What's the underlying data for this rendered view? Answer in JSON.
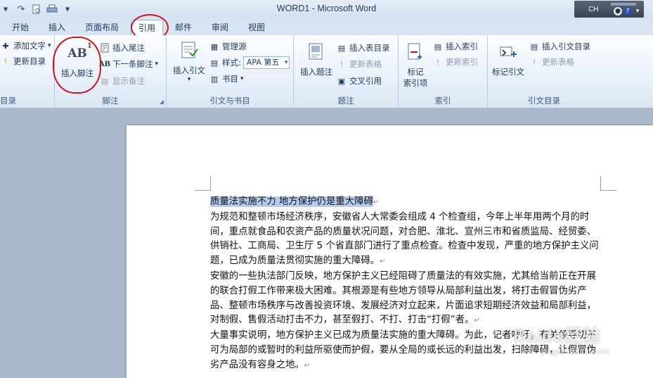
{
  "window": {
    "title": "WORD1  -  Microsoft Word"
  },
  "lang_indicator": {
    "label": "CH"
  },
  "help_button": {
    "label": "?"
  },
  "tabs": [
    {
      "label": "开始"
    },
    {
      "label": "插入"
    },
    {
      "label": "页面布局"
    },
    {
      "label": "引用"
    },
    {
      "label": "邮件"
    },
    {
      "label": "审阅"
    },
    {
      "label": "视图"
    }
  ],
  "ribbon": {
    "toc_group": {
      "label": "目录",
      "add_text": "添加文字",
      "update_toc": "更新目录"
    },
    "footnote_group": {
      "label": "脚注",
      "insert_footnote": "插入脚注",
      "insert_endnote": "插入尾注",
      "next_footnote": "下一条脚注",
      "show_notes": "显示备注"
    },
    "citation_group": {
      "label": "引文与书目",
      "insert_citation": "插入引文",
      "manage_sources": "管理源",
      "style_label": "样式:",
      "style_value": "APA 第五",
      "bibliography": "书目"
    },
    "caption_group": {
      "label": "题注",
      "insert_caption": "插入题注",
      "insert_table_of_figures": "插入表目录",
      "update_table": "更新表格",
      "cross_reference": "交叉引用"
    },
    "index_group": {
      "label": "索引",
      "mark_entry_line1": "标记",
      "mark_entry_line2": "索引项",
      "insert_index": "插入索引",
      "update_index": "更新索引"
    },
    "toa_group": {
      "label": "引文目录",
      "mark_citation": "标记引文",
      "insert_toa": "插入引文目录",
      "update_table": "更新表格"
    }
  },
  "document": {
    "title": "质量法实施不力  地方保护仍是重大障碍",
    "paragraphs": [
      "为规范和整顿市场经济秩序，安徽省人大常委会组成 4 个检查组，今年上半年用两个月的时间，重点就食品和农资产品的质量状况问题，对合肥、淮北、宣州三市和省质监局、经贸委、供销社、工商局、卫生厅 5 个省直部门进行了重点检查。检查中发现，严重的地方保护主义问题，已成为质量法贯彻实施的重大障碍。",
      "安徽的一些执法部门反映，地方保护主义已经阻碍了质量法的有效实施，尤其给当前正在开展的联合打假工作带来极大困难。其根源是有些地方领导从局部利益出发，将打击假冒伪劣产品、整顿市场秩序与改善投资环境、发展经济对立起来，片面追求短期经济效益和局部利益，对制假、售假活动打击不力，甚至假打、不打、打击“打假”者。",
      "大量事实说明，地方保护主义已成为质量法实施的重大障碍。为此，记者呼吁，有关领导切不可为局部的或暂时的利益所驱使而护假，要从全局的或长远的利益出发，扫除障碍，让假冒伪劣产品没有容身之地。"
    ],
    "paragraph_mark": "↵"
  },
  "watermark": {
    "line1": "Baidu经验",
    "line2": "jingyan.baidu.com"
  }
}
